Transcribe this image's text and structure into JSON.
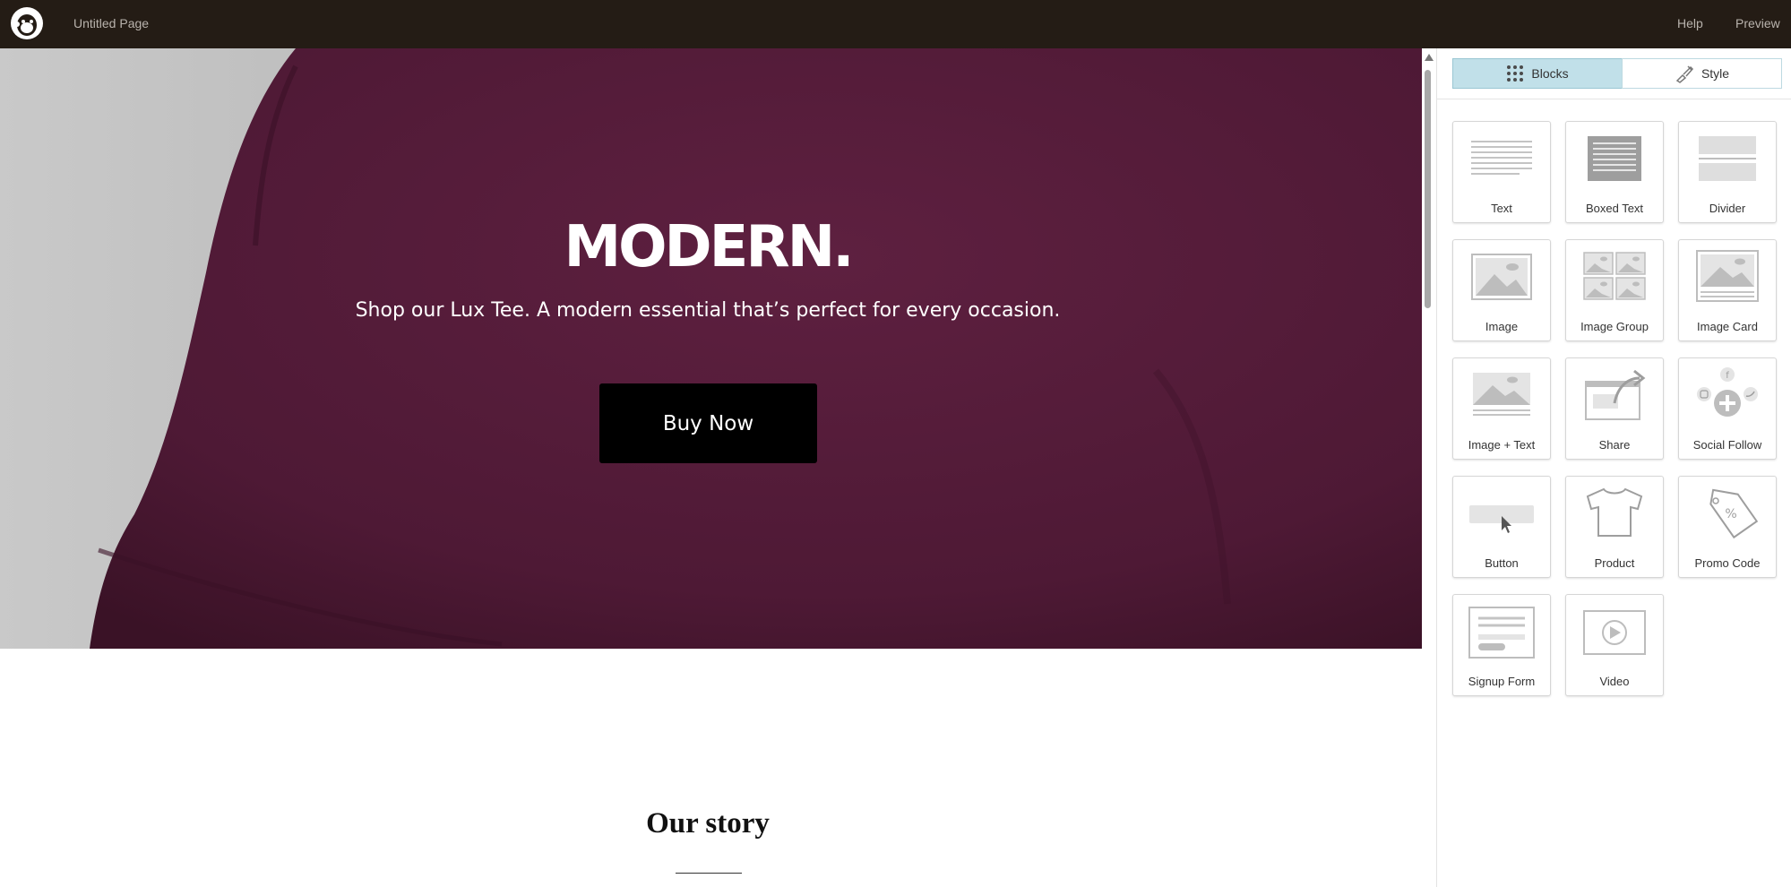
{
  "topbar": {
    "page_title": "Untitled Page",
    "help": "Help",
    "preview": "Preview",
    "logo_icon": "mailchimp-logo-icon"
  },
  "hero": {
    "title": "MODERN.",
    "subtitle": "Shop our Lux Tee. A modern essential that’s perfect for every occasion.",
    "button_label": "Buy Now",
    "background_color": "#5a1d3c"
  },
  "story": {
    "heading": "Our story"
  },
  "panel": {
    "tabs": [
      {
        "label": "Blocks",
        "icon": "grid-dots-icon",
        "active": true
      },
      {
        "label": "Style",
        "icon": "paint-brush-icon",
        "active": false
      }
    ],
    "blocks": [
      {
        "label": "Text",
        "icon": "text-block-icon"
      },
      {
        "label": "Boxed Text",
        "icon": "boxed-text-block-icon"
      },
      {
        "label": "Divider",
        "icon": "divider-block-icon"
      },
      {
        "label": "Image",
        "icon": "image-block-icon"
      },
      {
        "label": "Image Group",
        "icon": "image-group-block-icon"
      },
      {
        "label": "Image Card",
        "icon": "image-card-block-icon"
      },
      {
        "label": "Image + Text",
        "icon": "image-text-block-icon"
      },
      {
        "label": "Share",
        "icon": "share-block-icon"
      },
      {
        "label": "Social Follow",
        "icon": "social-follow-block-icon"
      },
      {
        "label": "Button",
        "icon": "button-block-icon"
      },
      {
        "label": "Product",
        "icon": "product-block-icon"
      },
      {
        "label": "Promo Code",
        "icon": "promo-code-block-icon"
      },
      {
        "label": "Signup Form",
        "icon": "signup-form-block-icon"
      },
      {
        "label": "Video",
        "icon": "video-block-icon"
      }
    ],
    "accent_color": "#c1e0e9"
  }
}
